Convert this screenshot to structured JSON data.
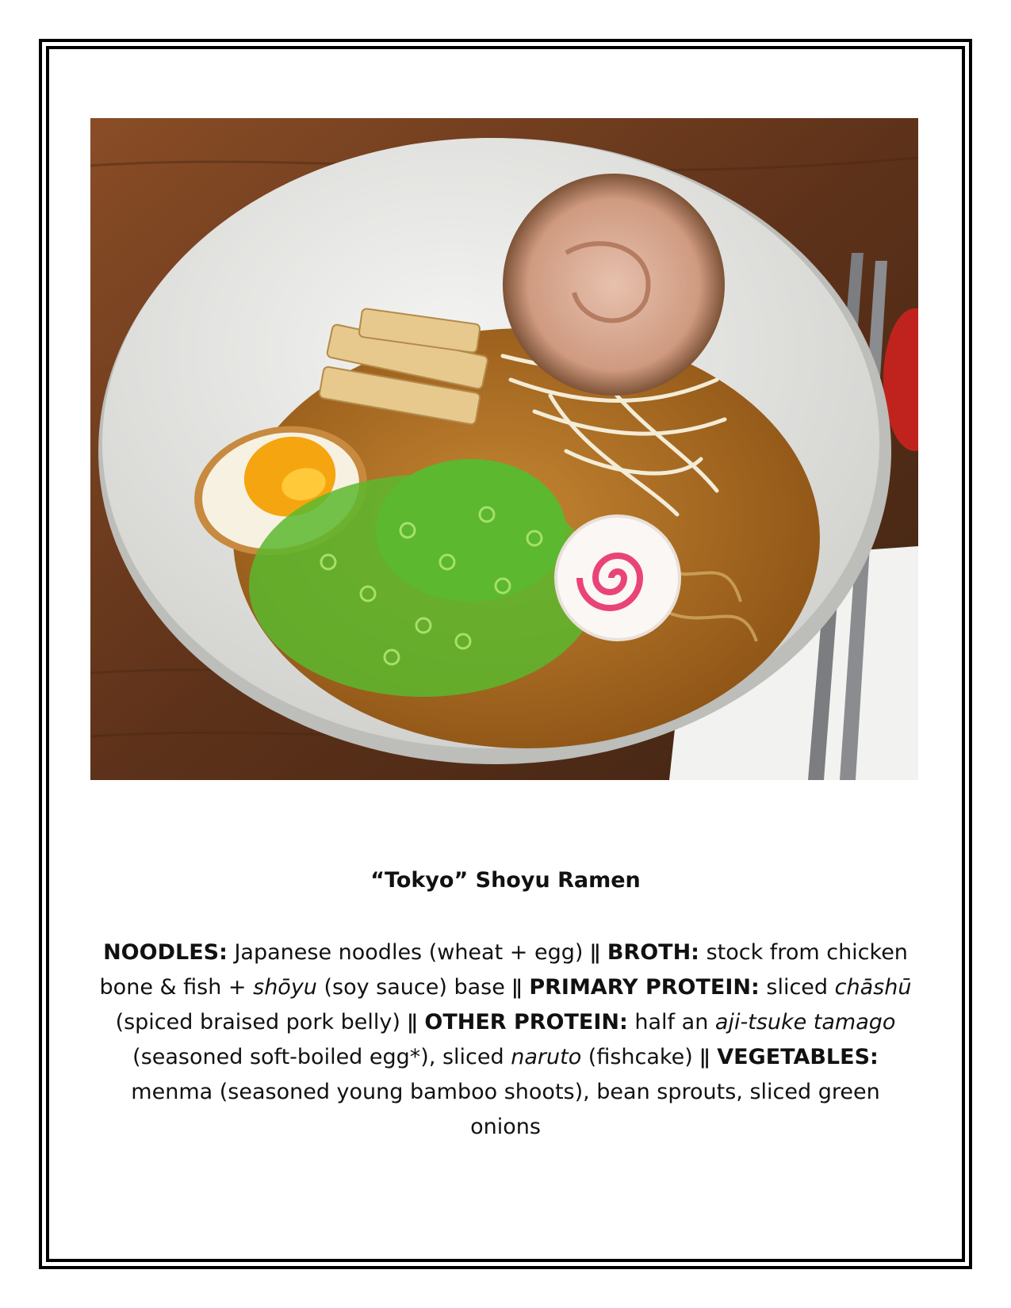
{
  "dish": {
    "title": "“Tokyo” Shoyu Ramen",
    "description": {
      "noodles_label": "NOODLES:",
      "noodles_text": " Japanese noodles (wheat + egg) ǁ ",
      "broth_label": "BROTH:",
      "broth_text_1": " stock from chicken bone & fish + ",
      "broth_shoyu": "shōyu",
      "broth_text_2": " (soy sauce) base ǁ ",
      "primary_label": "PRIMARY PROTEIN:",
      "primary_text_1": " sliced ",
      "primary_chashu": "chāshū",
      "primary_text_2": " (spiced braised pork belly) ǁ ",
      "other_label": "OTHER PROTEIN:",
      "other_text_1": " half an ",
      "other_egg": "aji-tsuke tamago",
      "other_text_2": " (seasoned soft-boiled egg*), sliced ",
      "other_naruto": "naruto",
      "other_text_3": " (fishcake) ǁ ",
      "veg_label": "VEGETABLES:",
      "veg_text": " menma (seasoned young bamboo shoots), bean sprouts, sliced green onions"
    }
  },
  "colors": {
    "frame": "#000000",
    "table_wood": "#6b3a1f",
    "bowl": "#e9e9e6",
    "broth": "#a9681e",
    "green_onion": "#5cb82e",
    "yolk": "#f5a50f",
    "naruto_swirl": "#e9447a"
  }
}
